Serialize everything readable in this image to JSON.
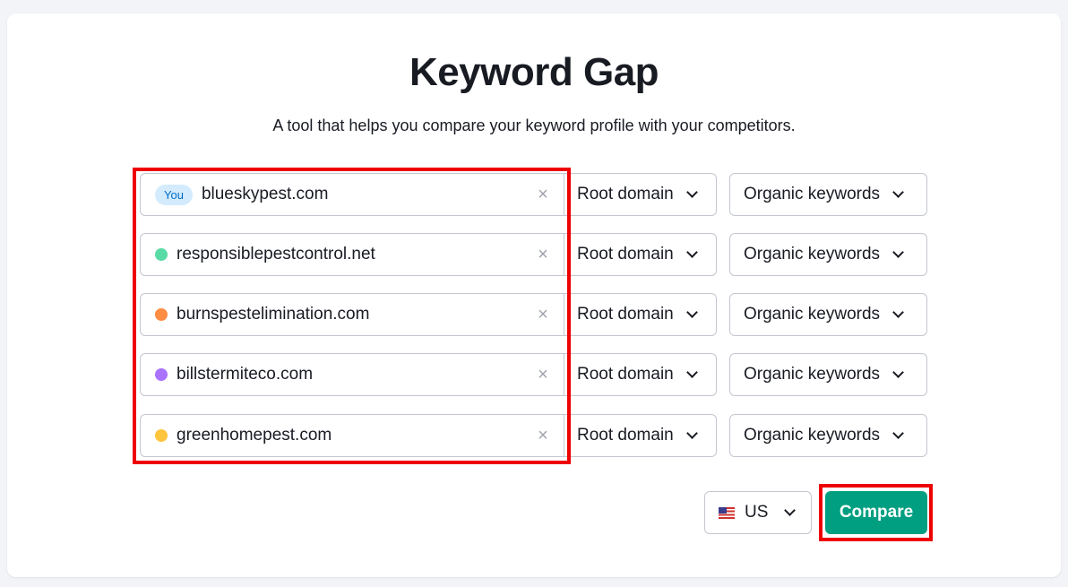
{
  "page": {
    "title": "Keyword Gap",
    "subtitle": "A tool that helps you compare your keyword profile with your competitors."
  },
  "domains": [
    {
      "badge": "You",
      "value": "blueskypest.com",
      "dot_color": null,
      "scope": "Root domain",
      "keyword_type": "Organic keywords"
    },
    {
      "badge": null,
      "value": "responsiblepestcontrol.net",
      "dot_color": "#59dba6",
      "scope": "Root domain",
      "keyword_type": "Organic keywords"
    },
    {
      "badge": null,
      "value": "burnspestelimination.com",
      "dot_color": "#ff8c43",
      "scope": "Root domain",
      "keyword_type": "Organic keywords"
    },
    {
      "badge": null,
      "value": "billstermiteco.com",
      "dot_color": "#a972ff",
      "scope": "Root domain",
      "keyword_type": "Organic keywords"
    },
    {
      "badge": null,
      "value": "greenhomepest.com",
      "dot_color": "#ffc53d",
      "scope": "Root domain",
      "keyword_type": "Organic keywords"
    }
  ],
  "icons": {
    "clear": "×",
    "chevron": "chevron-down-icon",
    "flag": "us-flag-icon"
  },
  "database": {
    "country": "US"
  },
  "actions": {
    "compare_label": "Compare",
    "compare_color": "#009f81"
  },
  "annotations": {
    "highlight_color": "#ee0000"
  }
}
